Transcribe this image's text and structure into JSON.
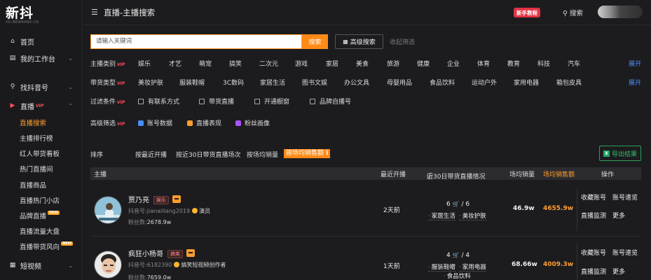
{
  "sidebar": {
    "logo": "新抖",
    "logo_sub": "XD.NEWRANK.CN",
    "items": [
      {
        "label": "首页"
      },
      {
        "label": "我的工作台"
      },
      {
        "label": "找抖音号"
      },
      {
        "label": "直播",
        "vip": "VIP"
      },
      {
        "label": "短视频"
      }
    ],
    "live_sub": [
      {
        "label": "直播搜索"
      },
      {
        "label": "主播排行榜"
      },
      {
        "label": "红人带货看板"
      },
      {
        "label": "热门直播间"
      },
      {
        "label": "直播商品"
      },
      {
        "label": "直播热门小店"
      },
      {
        "label": "品牌直播",
        "badge": "NEW"
      },
      {
        "label": "直播流量大盘"
      },
      {
        "label": "直播带货风向",
        "badge": "NEW"
      }
    ]
  },
  "topbar": {
    "title": "直播-主播搜索",
    "newbie": "新手教程",
    "search": "搜索"
  },
  "search": {
    "placeholder": "请输入关键词",
    "button": "搜索",
    "advanced": "高级搜索",
    "collapse": "收起筛选"
  },
  "filters": {
    "anchor_type": {
      "label": "主播类别",
      "vip": "VIP",
      "options": [
        "娱乐",
        "才艺",
        "萌宠",
        "搞笑",
        "二次元",
        "游戏",
        "家居",
        "美食",
        "旅游",
        "健康",
        "企业",
        "体育",
        "教育",
        "科技",
        "汽车"
      ],
      "expand": "展开"
    },
    "goods_type": {
      "label": "带货类型",
      "vip": "VIP",
      "options": [
        "美妆护肤",
        "服装鞋帽",
        "3C数码",
        "家居生活",
        "图书文娱",
        "办公文具",
        "母婴用品",
        "食品饮料",
        "运动户外",
        "家用电器",
        "箱包皮具"
      ],
      "expand": "展开"
    },
    "filter_cond": {
      "label": "过滤条件",
      "vip": "VIP",
      "options": [
        "有联系方式",
        "带货直播",
        "开通橱窗",
        "品牌自播号"
      ]
    },
    "advanced": {
      "label": "高级筛选",
      "vip": "VIP",
      "options": [
        "账号数据",
        "直播表现",
        "粉丝画像"
      ]
    }
  },
  "sort": {
    "label": "排序",
    "options": [
      "按最近开播",
      "按近30日带货直播场次",
      "按场均销量",
      "按场均销售额"
    ],
    "export": "导出结果"
  },
  "table": {
    "headers": {
      "anchor": "主播",
      "last_live": "最近开播",
      "recent30": "近30日带货直播情况",
      "avg_sales": "场均销量",
      "avg_revenue": "场均销售额",
      "actions": "操作"
    },
    "rows": [
      {
        "name": "贾乃亮",
        "tag": "娱乐",
        "account": "抖音号:jianailiang2019",
        "category": "演员",
        "fans": "粉丝数:",
        "fans_value": "2678.9w",
        "last_live": "2天前",
        "ratio": "6",
        "ratio_total": "/ 6",
        "cats": [
          "家居生活",
          "美妆护肤"
        ],
        "avg_sales": "46.9w",
        "avg_revenue": "4655.9w",
        "ops": [
          "收藏账号",
          "账号速览",
          "直播监测",
          "更多"
        ]
      },
      {
        "name": "疯狂小杨哥",
        "tag": "搞笑",
        "account": "抖音号:6182390",
        "category": "搞笑短视频创作者",
        "fans": "粉丝数:",
        "fans_value": "7659.0w",
        "last_live": "1天前",
        "ratio": "4",
        "ratio_total": "/ 4",
        "cats": [
          "服装鞋帽",
          "家用电器",
          "食品饮料"
        ],
        "avg_sales": "68.66w",
        "avg_revenue": "4009.3w",
        "ops": [
          "收藏账号",
          "账号速览",
          "直播监测",
          "更多"
        ]
      }
    ]
  }
}
